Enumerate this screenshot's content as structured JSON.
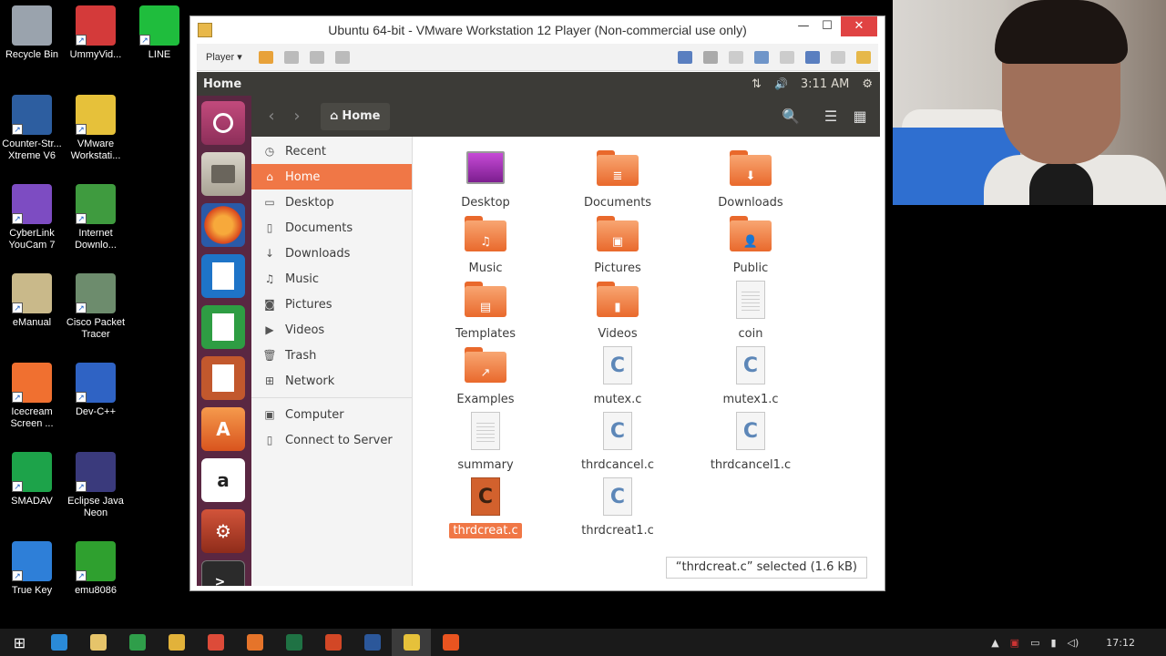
{
  "desktop": {
    "icons": [
      {
        "label": "Recycle Bin",
        "color": "#9aa3ad"
      },
      {
        "label": "UmmyVid...",
        "color": "#d43a3a"
      },
      {
        "label": "LINE",
        "color": "#1fbd3d"
      },
      {
        "label": "Counter-Str... Xtreme V6",
        "color": "#2d5ea0"
      },
      {
        "label": "VMware Workstati...",
        "color": "#e6c13a"
      },
      {
        "label": "CyberLink YouCam 7",
        "color": "#7d4cc2"
      },
      {
        "label": "Internet Downlo...",
        "color": "#3f9b3f"
      },
      {
        "label": "eManual",
        "color": "#c9b98a"
      },
      {
        "label": "Cisco Packet Tracer",
        "color": "#6d8c6d"
      },
      {
        "label": "Icecream Screen ...",
        "color": "#f07030"
      },
      {
        "label": "Dev-C++",
        "color": "#2f63c4"
      },
      {
        "label": "SMADAV",
        "color": "#1da34a"
      },
      {
        "label": "Eclipse Java Neon",
        "color": "#3a3a7c"
      },
      {
        "label": "True Key",
        "color": "#2e7fd8"
      },
      {
        "label": "emu8086",
        "color": "#2fa02f"
      }
    ]
  },
  "vmware": {
    "title": "Ubuntu 64-bit - VMware Workstation 12 Player (Non-commercial use only)",
    "player_label": "Player ▾",
    "min": "—",
    "max": "☐",
    "close": "✕"
  },
  "ubuntu": {
    "app_name": "Home",
    "time": "3:11 AM",
    "network_icon": "⇅",
    "volume_icon": "🔊",
    "gear_icon": "⚙"
  },
  "nautilus": {
    "back": "‹",
    "forward": "›",
    "path_label": "Home",
    "search_icon": "🔍",
    "list_icon": "☰",
    "grid_icon": "▦",
    "sidebar": [
      {
        "label": "Recent",
        "icon": "◷"
      },
      {
        "label": "Home",
        "icon": "⌂"
      },
      {
        "label": "Desktop",
        "icon": "▭"
      },
      {
        "label": "Documents",
        "icon": "▯"
      },
      {
        "label": "Downloads",
        "icon": "↓"
      },
      {
        "label": "Music",
        "icon": "♫"
      },
      {
        "label": "Pictures",
        "icon": "◙"
      },
      {
        "label": "Videos",
        "icon": "▶"
      },
      {
        "label": "Trash",
        "icon": "🗑"
      },
      {
        "label": "Network",
        "icon": "⊞"
      },
      {
        "label": "Computer",
        "icon": "▣"
      },
      {
        "label": "Connect to Server",
        "icon": "▯"
      }
    ],
    "files": [
      {
        "label": "Desktop",
        "kind": "desktop"
      },
      {
        "label": "Documents",
        "kind": "folder",
        "glyph": "≣"
      },
      {
        "label": "Downloads",
        "kind": "folder",
        "glyph": "⬇"
      },
      {
        "label": "Music",
        "kind": "folder",
        "glyph": "♫"
      },
      {
        "label": "Pictures",
        "kind": "folder",
        "glyph": "▣"
      },
      {
        "label": "Public",
        "kind": "folder",
        "glyph": "👤"
      },
      {
        "label": "Templates",
        "kind": "folder",
        "glyph": "▤"
      },
      {
        "label": "Videos",
        "kind": "folder",
        "glyph": "▮"
      },
      {
        "label": "coin",
        "kind": "doc"
      },
      {
        "label": "Examples",
        "kind": "folder",
        "glyph": "↗"
      },
      {
        "label": "mutex.c",
        "kind": "c"
      },
      {
        "label": "mutex1.c",
        "kind": "c"
      },
      {
        "label": "summary",
        "kind": "doc"
      },
      {
        "label": "thrdcancel.c",
        "kind": "c"
      },
      {
        "label": "thrdcancel1.c",
        "kind": "c"
      },
      {
        "label": "thrdcreat.c",
        "kind": "c-selected"
      },
      {
        "label": "thrdcreat1.c",
        "kind": "c"
      }
    ],
    "status": "“thrdcreat.c” selected  (1.6 kB)"
  },
  "taskbar": {
    "start_icon": "⊞",
    "apps": [
      {
        "name": "internet-explorer",
        "color": "#2a8ad8"
      },
      {
        "name": "file-explorer",
        "color": "#e6c46a"
      },
      {
        "name": "green-app",
        "color": "#2f9e4a"
      },
      {
        "name": "chrome",
        "color": "#e2b23a"
      },
      {
        "name": "chrome-2",
        "color": "#dd4b39"
      },
      {
        "name": "firefox",
        "color": "#e5742a"
      },
      {
        "name": "excel",
        "color": "#1f7244"
      },
      {
        "name": "powerpoint",
        "color": "#d24726"
      },
      {
        "name": "word",
        "color": "#2b579a"
      },
      {
        "name": "vmware",
        "color": "#e6c13a"
      },
      {
        "name": "ubuntu",
        "color": "#e95420"
      }
    ],
    "clock": "17:12"
  }
}
